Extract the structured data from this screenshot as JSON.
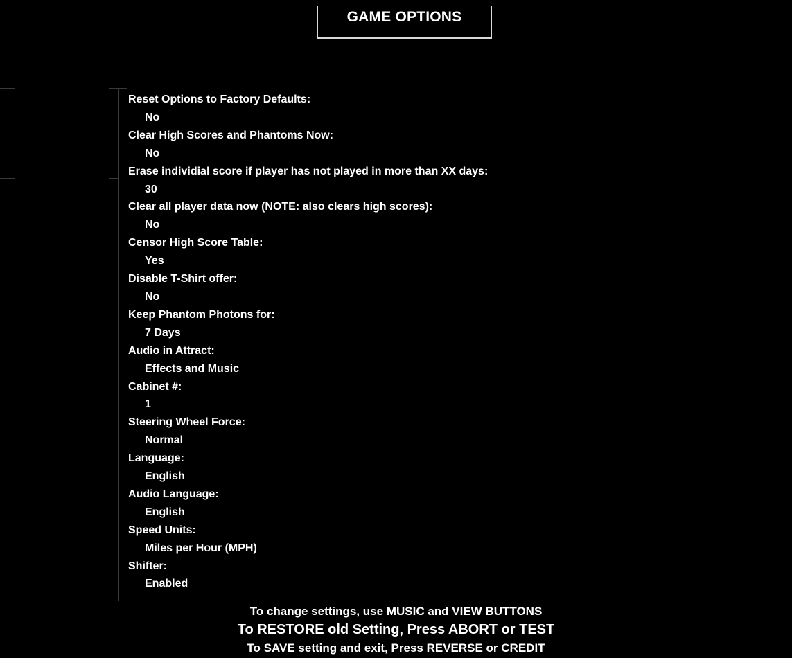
{
  "header": {
    "title": "GAME OPTIONS"
  },
  "options": [
    {
      "label": "Reset Options to Factory Defaults:",
      "value": "No"
    },
    {
      "label": "Clear High Scores and Phantoms Now:",
      "value": "No"
    },
    {
      "label": "Erase individial score if player has not played in more than XX days:",
      "value": "30"
    },
    {
      "label": "Clear all player data now (NOTE: also clears high scores):",
      "value": "No"
    },
    {
      "label": "Censor High Score Table:",
      "value": "Yes"
    },
    {
      "label": "Disable T-Shirt offer:",
      "value": "No"
    },
    {
      "label": "Keep Phantom Photons for:",
      "value": "7 Days"
    },
    {
      "label": "Audio in Attract:",
      "value": "Effects and Music"
    },
    {
      "label": "Cabinet #:",
      "value": "1"
    },
    {
      "label": "Steering Wheel Force:",
      "value": "Normal"
    },
    {
      "label": "Language:",
      "value": "English"
    },
    {
      "label": "Audio Language:",
      "value": "English"
    },
    {
      "label": "Speed Units:",
      "value": "Miles per Hour (MPH)"
    },
    {
      "label": "Shifter:",
      "value": "Enabled"
    }
  ],
  "instructions": {
    "line1": "To change settings, use MUSIC and VIEW BUTTONS",
    "line2": "To RESTORE old Setting, Press ABORT or TEST",
    "line3": "To SAVE setting and exit, Press REVERSE or CREDIT"
  },
  "colors": {
    "background": "#000000",
    "text": "#ffffff",
    "title_border": "#d8d8d8",
    "faint_frame": "#3a3a3a"
  }
}
